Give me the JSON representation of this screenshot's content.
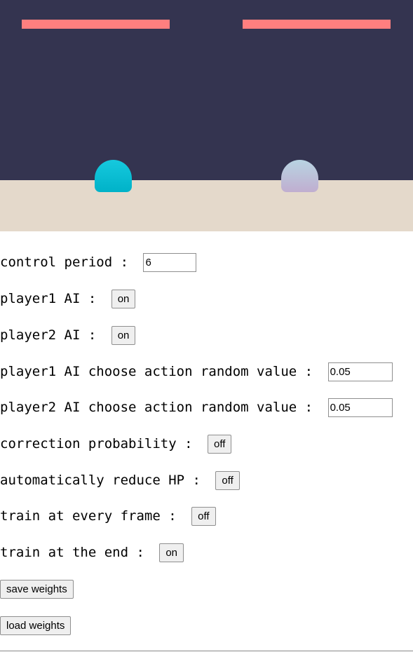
{
  "colors": {
    "sky": "#343450",
    "ground": "#e4d9cb",
    "hp_bar": "#ff7f7f",
    "player1": "#00bcd4",
    "player2": "#c4b8d8"
  },
  "game": {
    "player1_hp": 1.0,
    "player2_hp": 1.0
  },
  "controls": {
    "control_period": {
      "label": "control period : ",
      "value": "6"
    },
    "player1_ai": {
      "label": "player1 AI : ",
      "button": "on"
    },
    "player2_ai": {
      "label": "player2 AI : ",
      "button": "on"
    },
    "player1_random": {
      "label": "player1 AI choose action random value : ",
      "value": "0.05"
    },
    "player2_random": {
      "label": "player2 AI choose action random value : ",
      "value": "0.05"
    },
    "correction_probability": {
      "label": "correction probability : ",
      "button": "off"
    },
    "auto_reduce_hp": {
      "label": "automatically reduce HP : ",
      "button": "off"
    },
    "train_every_frame": {
      "label": "train at every frame : ",
      "button": "off"
    },
    "train_at_end": {
      "label": "train at the end : ",
      "button": "on"
    },
    "save_weights": {
      "button": "save weights"
    },
    "load_weights": {
      "button": "load weights"
    }
  }
}
